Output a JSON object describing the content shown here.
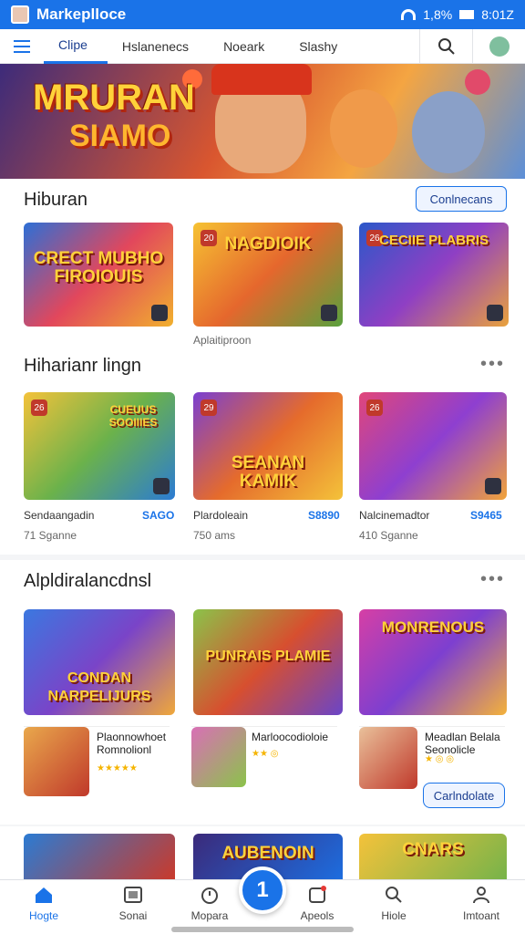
{
  "status_bar": {
    "app_title": "Markeplloce",
    "signal_text": "1,8%",
    "time": "8:01Z"
  },
  "tabs": [
    {
      "label": "Clipe"
    },
    {
      "label": "Hslanenecs"
    },
    {
      "label": "Noeark"
    },
    {
      "label": "Slashy"
    }
  ],
  "hero": {
    "title_line1": "MRURAN",
    "title_line2": "SIAMO"
  },
  "section1": {
    "title": "Hiburan",
    "button_label": "Conlnecans",
    "cards": [
      {
        "art_text": "CRECT MUBHO FIROIOUIS"
      },
      {
        "art_text": "NAGDIOIK",
        "badge": "20"
      },
      {
        "art_text": "CECIIE PLABRIS",
        "badge": "26"
      }
    ],
    "caption": "Aplaitiproon"
  },
  "section2": {
    "title": "Hiharianr lingn",
    "cards": [
      {
        "art_text": "CUEUUS SOOIIIES",
        "badge": "26",
        "name": "Sendaangadin",
        "price": "SAGO",
        "sub": "71 Sganne"
      },
      {
        "art_text": "SEANAN KAMIK",
        "badge": "29",
        "name": "Plardoleain",
        "price": "S8890",
        "sub": "750 ams"
      },
      {
        "art_text": "",
        "badge": "26",
        "name": "Nalcinemadtor",
        "price": "S9465",
        "sub": "410 Sganne"
      }
    ]
  },
  "section3": {
    "title": "Alpldiralancdnsl",
    "cards": [
      {
        "art_text": "CONDAN NARPELIJURS"
      },
      {
        "art_text": "PUNRAIS PLAMIE"
      },
      {
        "art_text": "MONRENOUS"
      }
    ],
    "minis": [
      {
        "name": "Plaonnowhoet Romnolionl",
        "stars": "★★★★★"
      },
      {
        "name": "Marloocodioloie",
        "stars": "★★ ◎"
      },
      {
        "name": "Meadlan Belala Seonolicle",
        "stars": "★ ◎ ◎"
      }
    ],
    "button_label": "Carlndolate"
  },
  "section4": {
    "cards": [
      {
        "art_text": ""
      },
      {
        "art_text": "AUBENOIN"
      },
      {
        "art_text": "CNARS"
      }
    ]
  },
  "bottom_nav": [
    {
      "label": "Hogte",
      "icon": "home-icon"
    },
    {
      "label": "Sonai",
      "icon": "store-icon"
    },
    {
      "label": "Mopara",
      "icon": "clock-icon"
    },
    {
      "label": "Apeols",
      "icon": "apps-icon"
    },
    {
      "label": "Hiole",
      "icon": "search-icon"
    },
    {
      "label": "Imtoant",
      "icon": "person-icon"
    }
  ],
  "fab_label": "1",
  "colors": {
    "accent": "#1a73e8",
    "title_yellow": "#ffd23a",
    "price": "#1a73e8"
  }
}
